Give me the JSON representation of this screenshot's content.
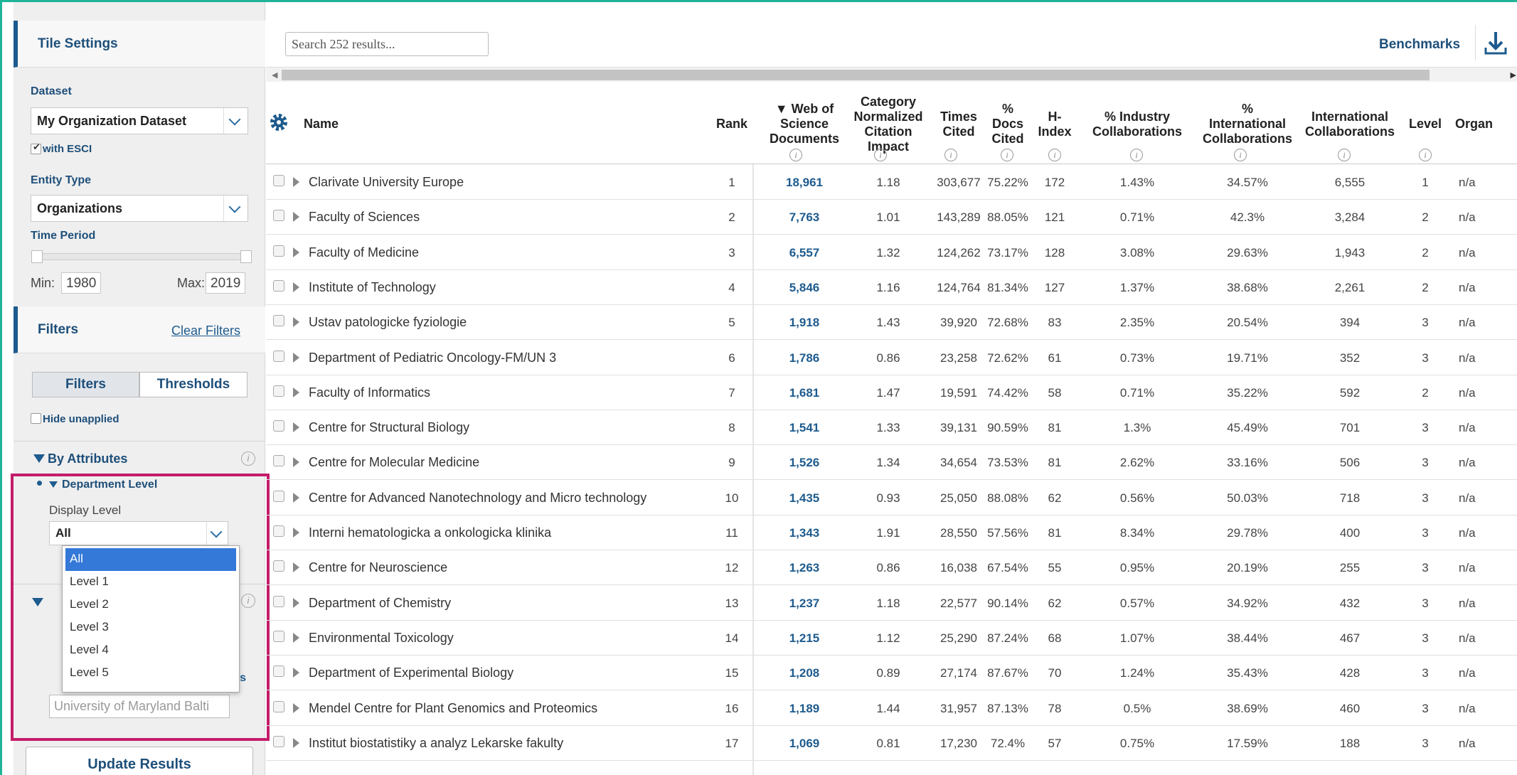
{
  "sidebar": {
    "tile_settings": "Tile Settings",
    "dataset_label": "Dataset",
    "dataset_value": "My Organization Dataset",
    "with_esci": "with ESCI",
    "entity_type_label": "Entity Type",
    "entity_type_value": "Organizations",
    "time_period_label": "Time Period",
    "min_label": "Min:",
    "min_value": "1980",
    "max_label": "Max:",
    "max_value": "2019",
    "filters_title": "Filters",
    "clear_filters": "Clear Filters",
    "tab_filters": "Filters",
    "tab_thresholds": "Thresholds",
    "hide_unapplied": "Hide unapplied",
    "by_attributes": "By Attributes",
    "department_level": "Department Level",
    "display_level_label": "Display Level",
    "display_level_value": "All",
    "dropdown_options": [
      "All",
      "Level 1",
      "Level 2",
      "Level 3",
      "Level 4",
      "Level 5"
    ],
    "partial_text": "nts",
    "org_input_value": "University of Maryland Balti",
    "update_results": "Update Results"
  },
  "toolbar": {
    "search_placeholder": "Search 252 results...",
    "benchmarks": "Benchmarks"
  },
  "table": {
    "headers": {
      "name": "Name",
      "rank": "Rank",
      "wos": [
        "▼ Web of",
        "Science",
        "Documents"
      ],
      "cnci": [
        "Category",
        "Normalized",
        "Citation",
        "Impact"
      ],
      "times_cited": [
        "Times",
        "Cited"
      ],
      "docs_cited": [
        "%",
        "Docs",
        "Cited"
      ],
      "h_index": [
        "H-",
        "Index"
      ],
      "industry": [
        "% Industry",
        "Collaborations"
      ],
      "intl_pct": [
        "%",
        "International",
        "Collaborations"
      ],
      "intl": [
        "International",
        "Collaborations"
      ],
      "level": "Level",
      "organ": "Organ"
    },
    "rows": [
      {
        "name": "Clarivate University Europe",
        "rank": "1",
        "wos": "18,961",
        "cnci": "1.18",
        "tc": "303,677",
        "dc": "75.22%",
        "h": "172",
        "ind": "1.43%",
        "ip": "34.57%",
        "ic": "6,555",
        "lvl": "1",
        "org": "n/a"
      },
      {
        "name": "Faculty of Sciences",
        "rank": "2",
        "wos": "7,763",
        "cnci": "1.01",
        "tc": "143,289",
        "dc": "88.05%",
        "h": "121",
        "ind": "0.71%",
        "ip": "42.3%",
        "ic": "3,284",
        "lvl": "2",
        "org": "n/a"
      },
      {
        "name": "Faculty of Medicine",
        "rank": "3",
        "wos": "6,557",
        "cnci": "1.32",
        "tc": "124,262",
        "dc": "73.17%",
        "h": "128",
        "ind": "3.08%",
        "ip": "29.63%",
        "ic": "1,943",
        "lvl": "2",
        "org": "n/a"
      },
      {
        "name": "Institute of Technology",
        "rank": "4",
        "wos": "5,846",
        "cnci": "1.16",
        "tc": "124,764",
        "dc": "81.34%",
        "h": "127",
        "ind": "1.37%",
        "ip": "38.68%",
        "ic": "2,261",
        "lvl": "2",
        "org": "n/a"
      },
      {
        "name": "Ustav patologicke fyziologie",
        "rank": "5",
        "wos": "1,918",
        "cnci": "1.43",
        "tc": "39,920",
        "dc": "72.68%",
        "h": "83",
        "ind": "2.35%",
        "ip": "20.54%",
        "ic": "394",
        "lvl": "3",
        "org": "n/a"
      },
      {
        "name": "Department of Pediatric Oncology-FM/UN 3",
        "rank": "6",
        "wos": "1,786",
        "cnci": "0.86",
        "tc": "23,258",
        "dc": "72.62%",
        "h": "61",
        "ind": "0.73%",
        "ip": "19.71%",
        "ic": "352",
        "lvl": "3",
        "org": "n/a"
      },
      {
        "name": "Faculty of Informatics",
        "rank": "7",
        "wos": "1,681",
        "cnci": "1.47",
        "tc": "19,591",
        "dc": "74.42%",
        "h": "58",
        "ind": "0.71%",
        "ip": "35.22%",
        "ic": "592",
        "lvl": "2",
        "org": "n/a"
      },
      {
        "name": "Centre for Structural Biology",
        "rank": "8",
        "wos": "1,541",
        "cnci": "1.33",
        "tc": "39,131",
        "dc": "90.59%",
        "h": "81",
        "ind": "1.3%",
        "ip": "45.49%",
        "ic": "701",
        "lvl": "3",
        "org": "n/a"
      },
      {
        "name": "Centre for Molecular Medicine",
        "rank": "9",
        "wos": "1,526",
        "cnci": "1.34",
        "tc": "34,654",
        "dc": "73.53%",
        "h": "81",
        "ind": "2.62%",
        "ip": "33.16%",
        "ic": "506",
        "lvl": "3",
        "org": "n/a"
      },
      {
        "name": "Centre for Advanced Nanotechnology and Micro technology",
        "rank": "10",
        "wos": "1,435",
        "cnci": "0.93",
        "tc": "25,050",
        "dc": "88.08%",
        "h": "62",
        "ind": "0.56%",
        "ip": "50.03%",
        "ic": "718",
        "lvl": "3",
        "org": "n/a"
      },
      {
        "name": "Interni hematologicka a onkologicka klinika",
        "rank": "11",
        "wos": "1,343",
        "cnci": "1.91",
        "tc": "28,550",
        "dc": "57.56%",
        "h": "81",
        "ind": "8.34%",
        "ip": "29.78%",
        "ic": "400",
        "lvl": "3",
        "org": "n/a"
      },
      {
        "name": "Centre for Neuroscience",
        "rank": "12",
        "wos": "1,263",
        "cnci": "0.86",
        "tc": "16,038",
        "dc": "67.54%",
        "h": "55",
        "ind": "0.95%",
        "ip": "20.19%",
        "ic": "255",
        "lvl": "3",
        "org": "n/a"
      },
      {
        "name": "Department of Chemistry",
        "rank": "13",
        "wos": "1,237",
        "cnci": "1.18",
        "tc": "22,577",
        "dc": "90.14%",
        "h": "62",
        "ind": "0.57%",
        "ip": "34.92%",
        "ic": "432",
        "lvl": "3",
        "org": "n/a"
      },
      {
        "name": "Environmental Toxicology",
        "rank": "14",
        "wos": "1,215",
        "cnci": "1.12",
        "tc": "25,290",
        "dc": "87.24%",
        "h": "68",
        "ind": "1.07%",
        "ip": "38.44%",
        "ic": "467",
        "lvl": "3",
        "org": "n/a"
      },
      {
        "name": "Department of Experimental Biology",
        "rank": "15",
        "wos": "1,208",
        "cnci": "0.89",
        "tc": "27,174",
        "dc": "87.67%",
        "h": "70",
        "ind": "1.24%",
        "ip": "35.43%",
        "ic": "428",
        "lvl": "3",
        "org": "n/a"
      },
      {
        "name": "Mendel Centre for Plant Genomics and Proteomics",
        "rank": "16",
        "wos": "1,189",
        "cnci": "1.44",
        "tc": "31,957",
        "dc": "87.13%",
        "h": "78",
        "ind": "0.5%",
        "ip": "38.69%",
        "ic": "460",
        "lvl": "3",
        "org": "n/a"
      },
      {
        "name": "Institut biostatistiky a analyz Lekarske fakulty",
        "rank": "17",
        "wos": "1,069",
        "cnci": "0.81",
        "tc": "17,230",
        "dc": "72.4%",
        "h": "57",
        "ind": "0.75%",
        "ip": "17.59%",
        "ic": "188",
        "lvl": "3",
        "org": "n/a"
      }
    ]
  },
  "colors": {
    "accent": "#1e5b8e",
    "highlight": "#c41d6a",
    "frame": "#1fb39a",
    "selected": "#3478d8"
  }
}
